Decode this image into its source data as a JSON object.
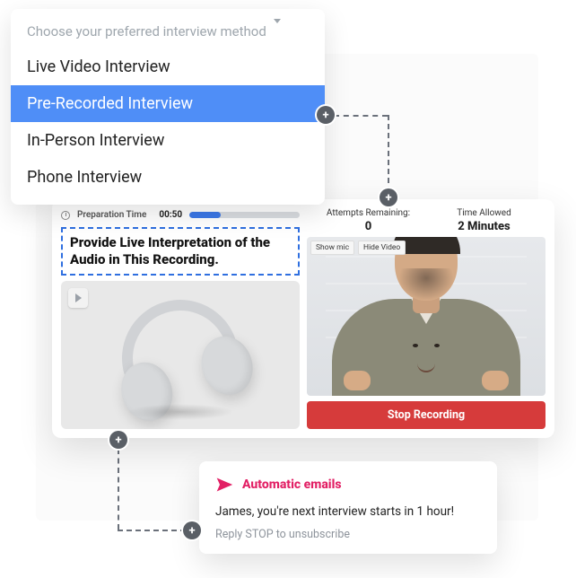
{
  "dropdown": {
    "placeholder": "Choose your preferred interview method",
    "options": [
      {
        "label": "Live Video Interview",
        "selected": false
      },
      {
        "label": "Pre-Recorded Interview",
        "selected": true
      },
      {
        "label": "In-Person Interview",
        "selected": false
      },
      {
        "label": "Phone Interview",
        "selected": false
      }
    ]
  },
  "panel": {
    "prep": {
      "label": "Preparation Time",
      "time": "00:50",
      "progress_pct": 28
    },
    "question": "Provide Live Interpretation of the Audio in This Recording.",
    "attempts": {
      "label": "Attempts Remaining:",
      "value": "0"
    },
    "time_allowed": {
      "label": "Time Allowed",
      "value": "2 Minutes"
    },
    "buttons": {
      "show_mic": "Show mic",
      "hide_video": "Hide Video",
      "stop": "Stop Recording"
    }
  },
  "email": {
    "title": "Automatic emails",
    "body": "James, you're next interview starts in 1 hour!",
    "footer": "Reply STOP to unsubscribe"
  },
  "colors": {
    "accent_blue": "#4f8ef7",
    "danger": "#d63b3b",
    "brand_pink": "#e22065"
  }
}
